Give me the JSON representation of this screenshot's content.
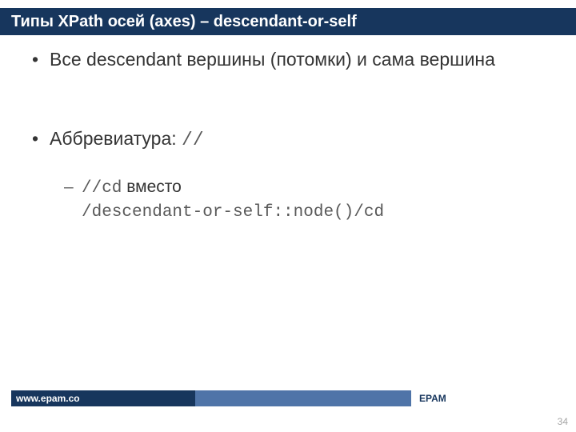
{
  "title": "Типы XPath осей (axes) – descendant-or-self",
  "bullets": {
    "b1": "Все descendant вершины (потомки) и сама вершина",
    "b2_prefix": "Аббревиатура: ",
    "b2_code": "//",
    "sub_code1": "//cd",
    "sub_mid": " вместо ",
    "sub_code2": "/descendant-or-self::node()/cd"
  },
  "footer": {
    "url": "www.epam.co",
    "brand": "EPAM"
  },
  "page_number": "34"
}
